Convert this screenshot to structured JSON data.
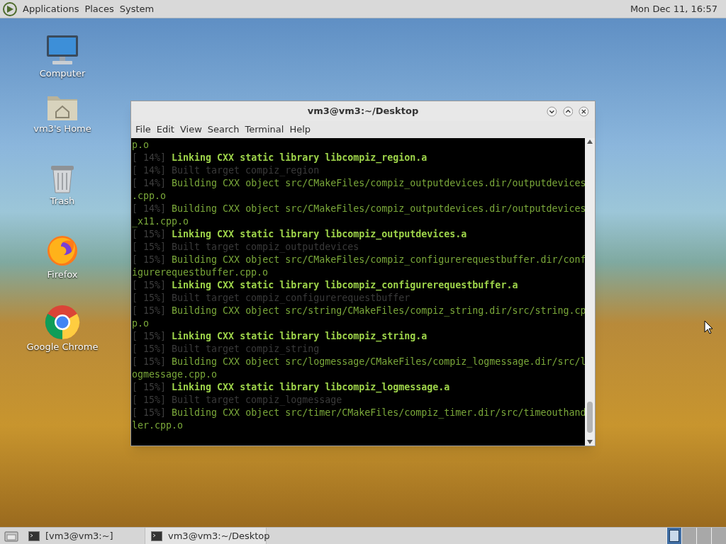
{
  "top_panel": {
    "menus": [
      "Applications",
      "Places",
      "System"
    ],
    "clock": "Mon Dec 11, 16:57"
  },
  "desktop_icons": [
    {
      "kind": "computer",
      "label": "Computer"
    },
    {
      "kind": "home",
      "label": "vm3's Home"
    },
    {
      "kind": "trash",
      "label": "Trash"
    },
    {
      "kind": "firefox",
      "label": "Firefox"
    },
    {
      "kind": "chrome",
      "label": "Google Chrome"
    }
  ],
  "window": {
    "title": "vm3@vm3:~/Desktop",
    "menu": [
      "File",
      "Edit",
      "View",
      "Search",
      "Terminal",
      "Help"
    ],
    "lines": [
      {
        "kind": "cont",
        "text": "p.o"
      },
      {
        "kind": "link",
        "prefix": "[ 14%]",
        "text": "Linking CXX static library libcompiz_region.a"
      },
      {
        "kind": "built",
        "text": "[ 14%] Built target compiz_region"
      },
      {
        "kind": "building",
        "prefix": "[ 14%]",
        "text": "Building CXX object src/CMakeFiles/compiz_outputdevices.dir/outputdevices"
      },
      {
        "kind": "cont",
        "text": ".cpp.o"
      },
      {
        "kind": "building",
        "prefix": "[ 14%]",
        "text": "Building CXX object src/CMakeFiles/compiz_outputdevices.dir/outputdevices"
      },
      {
        "kind": "cont",
        "text": "_x11.cpp.o"
      },
      {
        "kind": "link",
        "prefix": "[ 15%]",
        "text": "Linking CXX static library libcompiz_outputdevices.a"
      },
      {
        "kind": "built",
        "text": "[ 15%] Built target compiz_outputdevices"
      },
      {
        "kind": "building",
        "prefix": "[ 15%]",
        "text": "Building CXX object src/CMakeFiles/compiz_configurerequestbuffer.dir/conf"
      },
      {
        "kind": "cont",
        "text": "igurerequestbuffer.cpp.o"
      },
      {
        "kind": "link",
        "prefix": "[ 15%]",
        "text": "Linking CXX static library libcompiz_configurerequestbuffer.a"
      },
      {
        "kind": "built",
        "text": "[ 15%] Built target compiz_configurerequestbuffer"
      },
      {
        "kind": "building",
        "prefix": "[ 15%]",
        "text": "Building CXX object src/string/CMakeFiles/compiz_string.dir/src/string.cp"
      },
      {
        "kind": "cont",
        "text": "p.o"
      },
      {
        "kind": "link",
        "prefix": "[ 15%]",
        "text": "Linking CXX static library libcompiz_string.a"
      },
      {
        "kind": "built",
        "text": "[ 15%] Built target compiz_string"
      },
      {
        "kind": "building",
        "prefix": "[ 15%]",
        "text": "Building CXX object src/logmessage/CMakeFiles/compiz_logmessage.dir/src/l"
      },
      {
        "kind": "cont",
        "text": "ogmessage.cpp.o"
      },
      {
        "kind": "link",
        "prefix": "[ 15%]",
        "text": "Linking CXX static library libcompiz_logmessage.a"
      },
      {
        "kind": "built",
        "text": "[ 15%] Built target compiz_logmessage"
      },
      {
        "kind": "building",
        "prefix": "[ 15%]",
        "text": "Building CXX object src/timer/CMakeFiles/compiz_timer.dir/src/timeouthand"
      },
      {
        "kind": "cont",
        "text": "ler.cpp.o"
      }
    ]
  },
  "taskbar": {
    "items": [
      {
        "label": "[vm3@vm3:~]",
        "selected": false
      },
      {
        "label": "vm3@vm3:~/Desktop",
        "selected": true
      }
    ],
    "workspaces": [
      {
        "selected": true
      },
      {
        "selected": false
      },
      {
        "selected": false
      },
      {
        "selected": false
      }
    ]
  }
}
